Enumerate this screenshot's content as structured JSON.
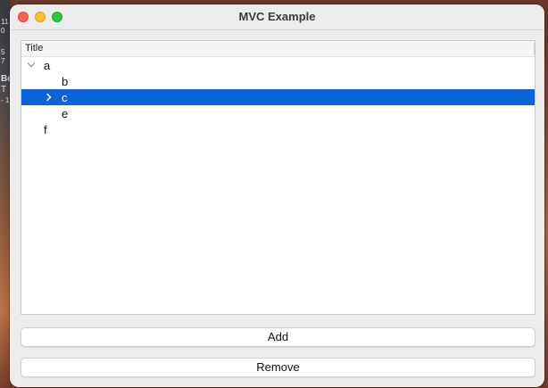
{
  "desktop": {
    "fragments": [
      "11",
      "0",
      "5",
      "7",
      "Bo",
      "T",
      "- 1"
    ]
  },
  "window": {
    "title": "MVC Example"
  },
  "tree": {
    "column_header": "Title",
    "rows": [
      {
        "label": "a",
        "depth": 0,
        "expander": "expanded",
        "selected": false
      },
      {
        "label": "b",
        "depth": 1,
        "expander": "none",
        "selected": false
      },
      {
        "label": "c",
        "depth": 1,
        "expander": "collapsed",
        "selected": true
      },
      {
        "label": "e",
        "depth": 1,
        "expander": "none",
        "selected": false
      },
      {
        "label": "f",
        "depth": 0,
        "expander": "none",
        "selected": false
      }
    ]
  },
  "buttons": {
    "add_label": "Add",
    "remove_label": "Remove"
  },
  "colors": {
    "selection": "#0a63d8",
    "close": "#fe5f57",
    "minimize": "#febc2e",
    "maximize": "#28c840"
  }
}
